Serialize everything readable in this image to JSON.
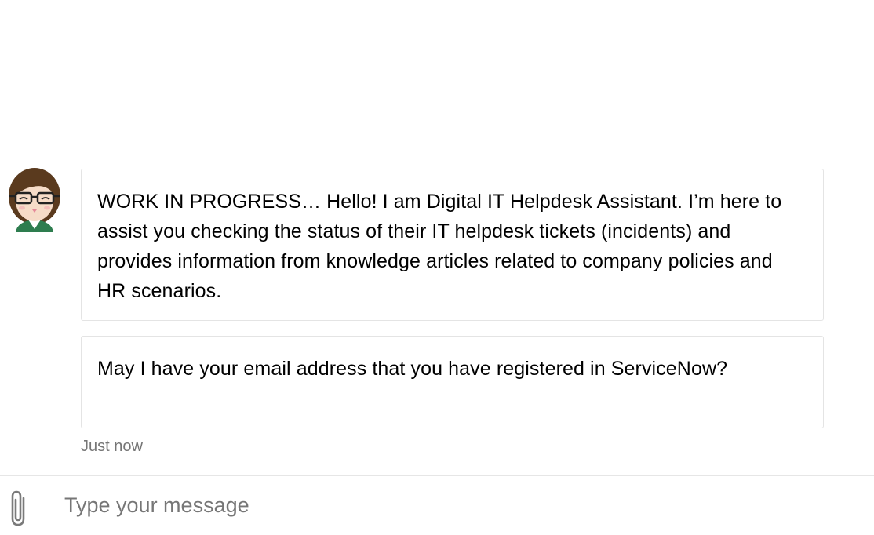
{
  "messages": [
    {
      "text": "WORK IN PROGRESS… Hello! I am Digital IT Helpdesk Assistant. I’m here to assist you checking the status of their IT helpdesk tickets (incidents) and provides information from knowledge articles related to company policies and HR scenarios."
    },
    {
      "text": "May I have your email address that you have registered in ServiceNow?"
    }
  ],
  "timestamp": "Just now",
  "composer": {
    "placeholder": "Type your message",
    "value": ""
  },
  "icons": {
    "avatar": "bot-avatar-icon",
    "attach": "paperclip-icon"
  }
}
